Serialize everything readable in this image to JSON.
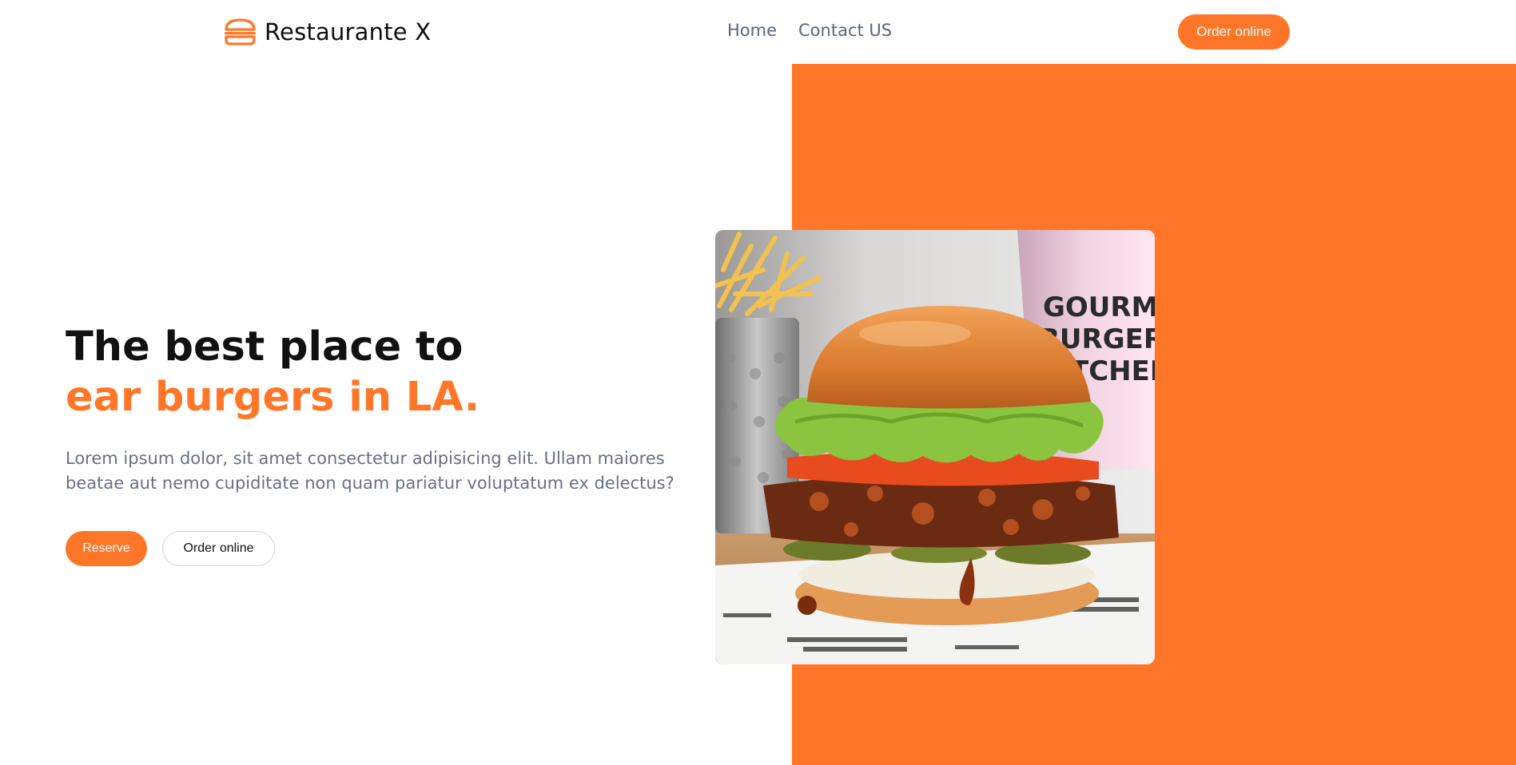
{
  "header": {
    "brand": "Restaurante X",
    "logo_icon": "burger-icon",
    "nav": [
      {
        "label": "Home"
      },
      {
        "label": "Contact US"
      }
    ],
    "order_button": "Order online"
  },
  "hero": {
    "title_line1": "The best place to",
    "title_line2": "ear burgers in LA.",
    "description": "Lorem ipsum dolor, sit amet consectetur adipisicing elit. Ullam maiores beatae aut nemo cupiditate non quam pariatur voluptatum ex delectus?",
    "reserve_button": "Reserve",
    "order_button": "Order online"
  },
  "image": {
    "cup_text": [
      "GOURMET",
      "BURGER",
      "KITCHEN"
    ]
  },
  "colors": {
    "accent": "#ff7629",
    "text_dark": "#111111",
    "text_muted": "#667085"
  }
}
